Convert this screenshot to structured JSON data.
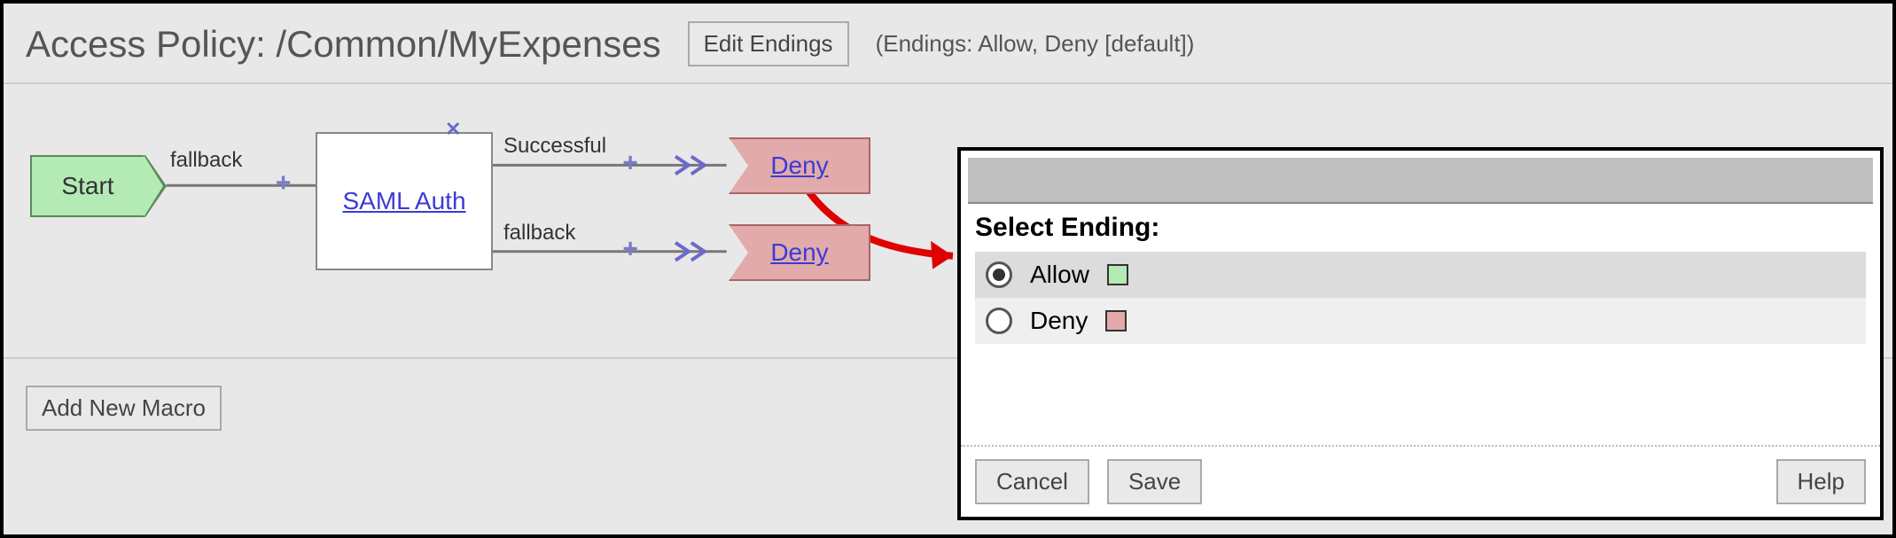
{
  "header": {
    "title": "Access Policy: /Common/MyExpenses",
    "edit_endings": "Edit Endings",
    "endings_note": "(Endings: Allow, Deny [default])"
  },
  "flow": {
    "start_label": "Start",
    "fallback_label_1": "fallback",
    "saml_label": "SAML Auth",
    "branch_successful": "Successful",
    "branch_fallback": "fallback",
    "deny_label_top": "Deny",
    "deny_label_bot": "Deny"
  },
  "footer": {
    "add_macro": "Add New Macro"
  },
  "dialog": {
    "heading": "Select Ending:",
    "options": [
      {
        "label": "Allow",
        "color": "green",
        "selected": true
      },
      {
        "label": "Deny",
        "color": "red",
        "selected": false
      }
    ],
    "cancel": "Cancel",
    "save": "Save",
    "help": "Help"
  }
}
